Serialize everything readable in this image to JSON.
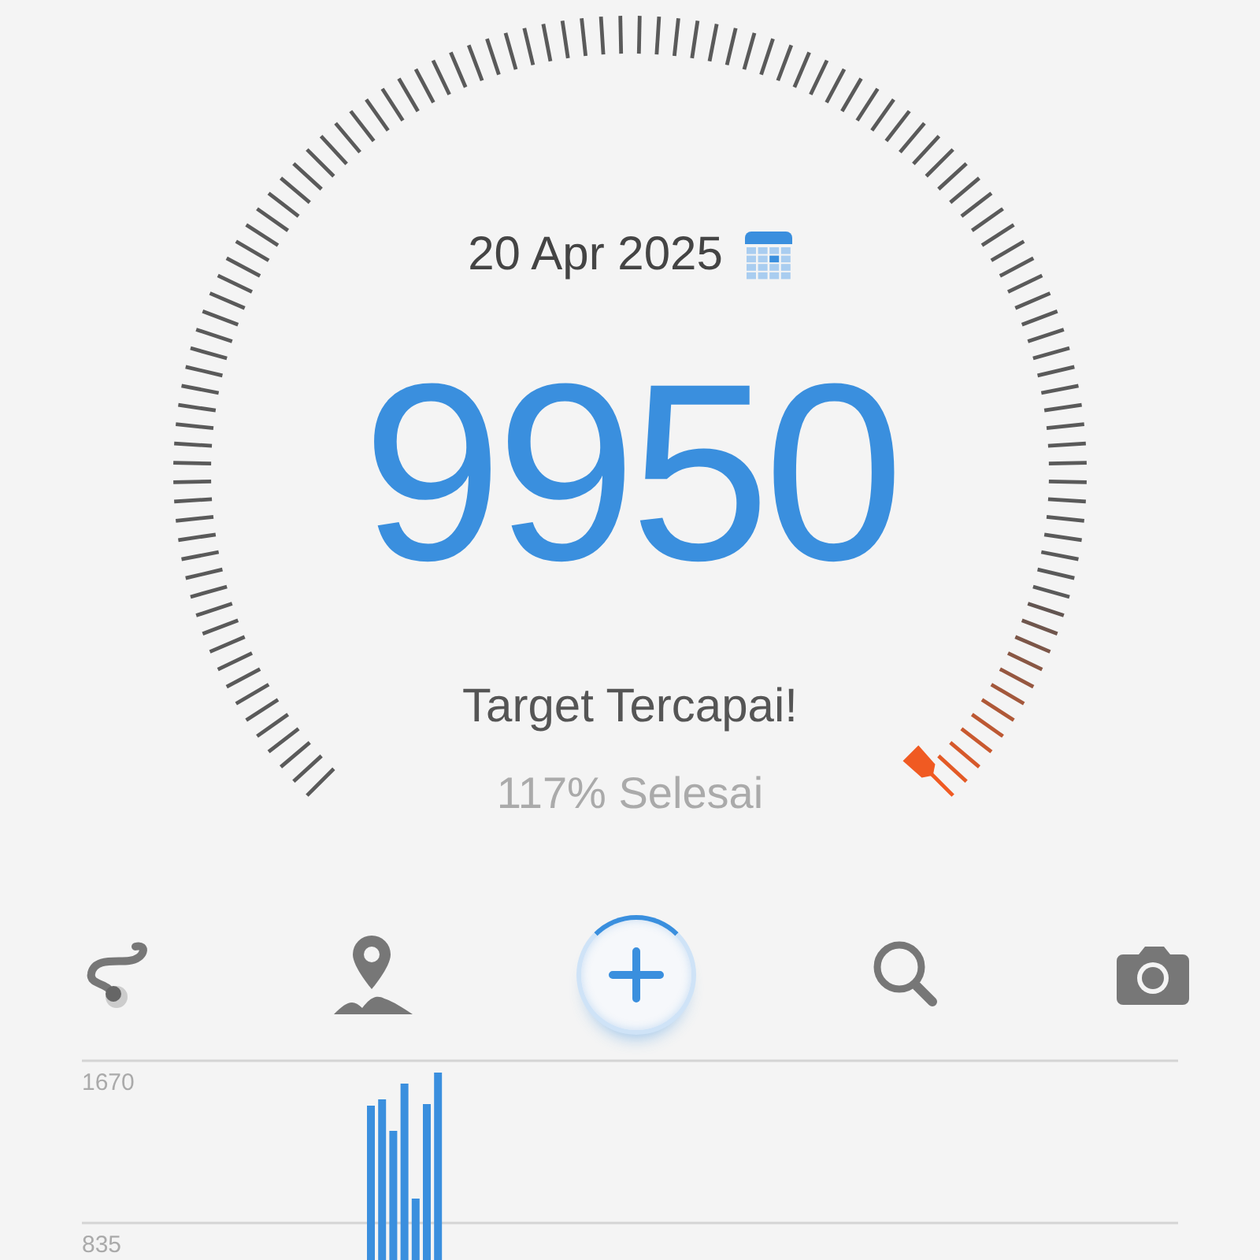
{
  "gauge": {
    "date": "20 Apr 2025",
    "steps": "9950",
    "status": "Target Tercapai!",
    "progress": "117% Selesai"
  },
  "chart": {
    "y_labels": [
      "1670",
      "835"
    ]
  }
}
